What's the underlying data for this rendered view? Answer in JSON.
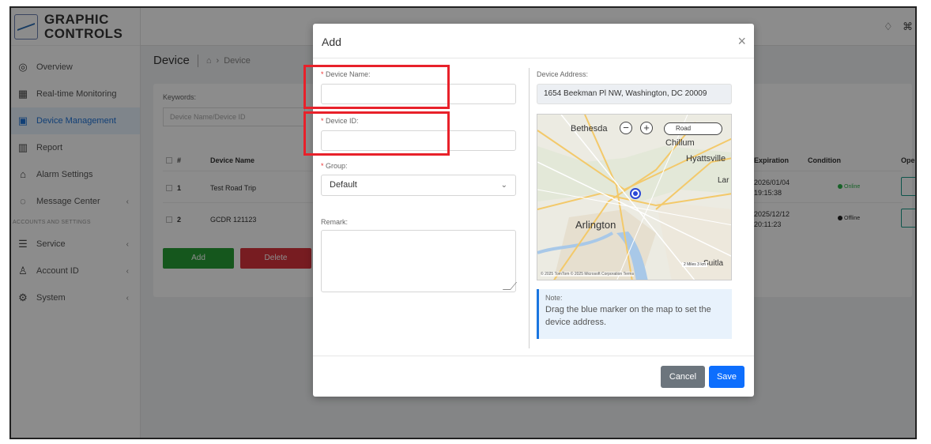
{
  "brand": {
    "line1": "GRAPHIC",
    "line2": "CONTROLS"
  },
  "sidebar": {
    "items": [
      {
        "label": "Overview",
        "icon": "dashboard-icon"
      },
      {
        "label": "Real-time Monitoring",
        "icon": "grid-icon"
      },
      {
        "label": "Device Management",
        "icon": "device-icon",
        "active": true
      },
      {
        "label": "Report",
        "icon": "chart-icon"
      },
      {
        "label": "Alarm Settings",
        "icon": "alarm-icon"
      },
      {
        "label": "Message Center",
        "icon": "message-icon"
      }
    ],
    "section_label": "ACCOUNTS AND SETTINGS",
    "items2": [
      {
        "label": "Service",
        "icon": "service-icon"
      },
      {
        "label": "Account ID",
        "icon": "user-icon"
      },
      {
        "label": "System",
        "icon": "gear-icon"
      }
    ]
  },
  "breadcrumb": {
    "title": "Device",
    "current": "Device"
  },
  "filter": {
    "keywords_label": "Keywords:",
    "keywords_placeholder": "Device Name/Device ID"
  },
  "table": {
    "headers": {
      "index": "#",
      "name": "Device Name",
      "expiration": "Expiration",
      "condition": "Condition",
      "operation": "Ope"
    },
    "rows": [
      {
        "index": "1",
        "name": "Test Road Trip",
        "exp_date": "2026/01/04",
        "exp_time": "19:15:38",
        "condition": "Online",
        "condition_color": "#2bb34a"
      },
      {
        "index": "2",
        "name": "GCDR 121123",
        "exp_date": "2025/12/12",
        "exp_time": "20:11:23",
        "condition": "Offline",
        "condition_color": "#222222"
      }
    ]
  },
  "actions": {
    "add": "Add",
    "delete": "Delete"
  },
  "modal": {
    "title": "Add",
    "close_icon": "close-icon",
    "device_name_label": "Device Name:",
    "device_id_label": "Device ID:",
    "group_label": "Group:",
    "group_value": "Default",
    "remark_label": "Remark:",
    "address_label": "Device Address:",
    "address_value": "1654 Beekman Pl NW, Washington, DC 20009",
    "map": {
      "labels": [
        "Bethesda",
        "Chillum",
        "Hyattsville",
        "Arlington",
        "Lar",
        "Suitla"
      ],
      "zoom_out": "−",
      "zoom_in": "+",
      "style": "Road",
      "attribution": "© 2025 TomTom  © 2025 Microsoft Corporation  Terms",
      "scale": "2 Miles    3 km"
    },
    "note_title": "Note:",
    "note_text": "Drag the blue marker on the map to set the device address.",
    "cancel": "Cancel",
    "save": "Save"
  }
}
